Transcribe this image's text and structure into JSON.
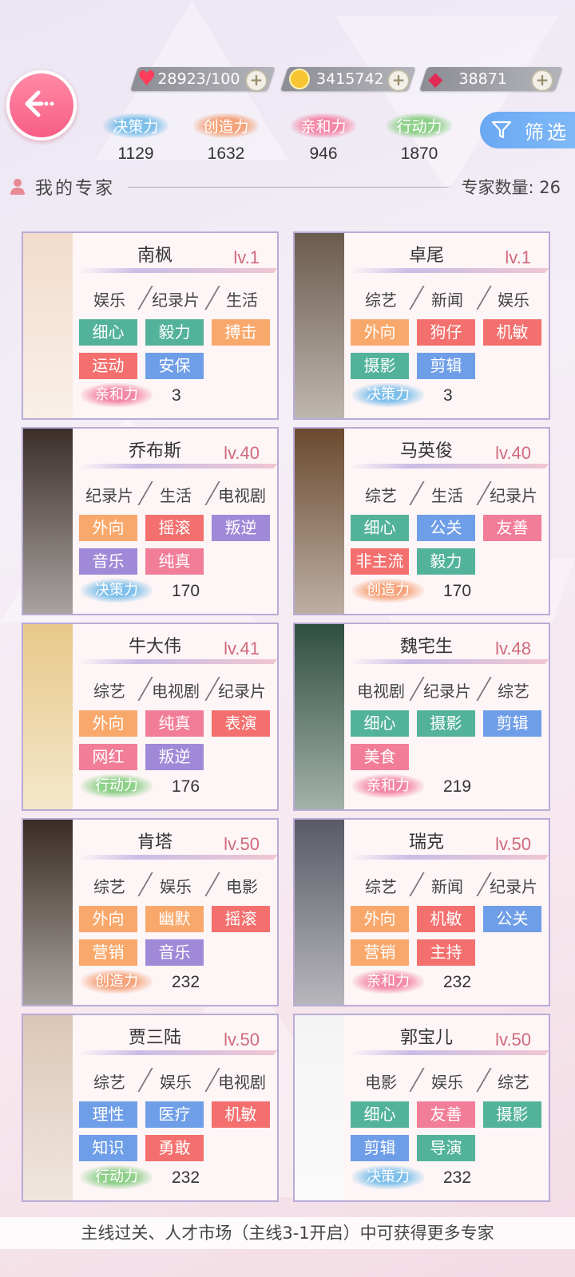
{
  "resources": [
    {
      "icon": "heart-icon",
      "value": "28923/100"
    },
    {
      "icon": "coin-icon",
      "value": "3415742"
    },
    {
      "icon": "gem-icon",
      "value": "38871"
    }
  ],
  "stats": [
    {
      "label": "决策力",
      "value": "1129",
      "color": "#7fc0ea"
    },
    {
      "label": "创造力",
      "value": "1632",
      "color": "#f4a37b"
    },
    {
      "label": "亲和力",
      "value": "946",
      "color": "#f388a8"
    },
    {
      "label": "行动力",
      "value": "1870",
      "color": "#8fd08a"
    }
  ],
  "filter_label": "筛选",
  "section": {
    "title": "我的专家",
    "count_label": "专家数量: 26"
  },
  "colors": {
    "green": "#53b39a",
    "red": "#f3706e",
    "orange": "#f9a86b",
    "blue": "#6f9ee8",
    "purple": "#a08ad8",
    "pink": "#f27d98"
  },
  "experts": [
    {
      "name": "南枫",
      "level": "lv.1",
      "cats": [
        "娱乐",
        "纪录片",
        "生活"
      ],
      "tags": [
        {
          "t": "细心",
          "c": "green"
        },
        {
          "t": "毅力",
          "c": "green"
        },
        {
          "t": "搏击",
          "c": "orange"
        },
        {
          "t": "运动",
          "c": "red"
        },
        {
          "t": "安保",
          "c": "blue"
        }
      ],
      "attr": "亲和力",
      "attr_color": "#f388a8",
      "value": "3"
    },
    {
      "name": "卓尾",
      "level": "lv.1",
      "cats": [
        "综艺",
        "新闻",
        "娱乐"
      ],
      "tags": [
        {
          "t": "外向",
          "c": "orange"
        },
        {
          "t": "狗仔",
          "c": "red"
        },
        {
          "t": "机敏",
          "c": "red"
        },
        {
          "t": "摄影",
          "c": "green"
        },
        {
          "t": "剪辑",
          "c": "blue"
        }
      ],
      "attr": "决策力",
      "attr_color": "#7fc0ea",
      "value": "3"
    },
    {
      "name": "乔布斯",
      "level": "lv.40",
      "cats": [
        "纪录片",
        "生活",
        "电视剧"
      ],
      "tags": [
        {
          "t": "外向",
          "c": "orange"
        },
        {
          "t": "摇滚",
          "c": "red"
        },
        {
          "t": "叛逆",
          "c": "purple"
        },
        {
          "t": "音乐",
          "c": "purple"
        },
        {
          "t": "纯真",
          "c": "pink"
        }
      ],
      "attr": "决策力",
      "attr_color": "#7fc0ea",
      "value": "170"
    },
    {
      "name": "马英俊",
      "level": "lv.40",
      "cats": [
        "综艺",
        "生活",
        "纪录片"
      ],
      "tags": [
        {
          "t": "细心",
          "c": "green"
        },
        {
          "t": "公关",
          "c": "blue"
        },
        {
          "t": "友善",
          "c": "pink"
        },
        {
          "t": "非主流",
          "c": "red"
        },
        {
          "t": "毅力",
          "c": "green"
        }
      ],
      "attr": "创造力",
      "attr_color": "#f4a37b",
      "value": "170"
    },
    {
      "name": "牛大伟",
      "level": "lv.41",
      "cats": [
        "综艺",
        "电视剧",
        "纪录片"
      ],
      "tags": [
        {
          "t": "外向",
          "c": "orange"
        },
        {
          "t": "纯真",
          "c": "pink"
        },
        {
          "t": "表演",
          "c": "red"
        },
        {
          "t": "网红",
          "c": "pink"
        },
        {
          "t": "叛逆",
          "c": "purple"
        }
      ],
      "attr": "行动力",
      "attr_color": "#8fd08a",
      "value": "176"
    },
    {
      "name": "魏宅生",
      "level": "lv.48",
      "cats": [
        "电视剧",
        "纪录片",
        "综艺"
      ],
      "tags": [
        {
          "t": "细心",
          "c": "green"
        },
        {
          "t": "摄影",
          "c": "green"
        },
        {
          "t": "剪辑",
          "c": "blue"
        },
        {
          "t": "美食",
          "c": "pink"
        }
      ],
      "attr": "亲和力",
      "attr_color": "#f388a8",
      "value": "219"
    },
    {
      "name": "肯塔",
      "level": "lv.50",
      "cats": [
        "综艺",
        "娱乐",
        "电影"
      ],
      "tags": [
        {
          "t": "外向",
          "c": "orange"
        },
        {
          "t": "幽默",
          "c": "orange"
        },
        {
          "t": "摇滚",
          "c": "red"
        },
        {
          "t": "营销",
          "c": "orange"
        },
        {
          "t": "音乐",
          "c": "purple"
        }
      ],
      "attr": "创造力",
      "attr_color": "#f4a37b",
      "value": "232"
    },
    {
      "name": "瑞克",
      "level": "lv.50",
      "cats": [
        "综艺",
        "新闻",
        "纪录片"
      ],
      "tags": [
        {
          "t": "外向",
          "c": "orange"
        },
        {
          "t": "机敏",
          "c": "red"
        },
        {
          "t": "公关",
          "c": "blue"
        },
        {
          "t": "营销",
          "c": "orange"
        },
        {
          "t": "主持",
          "c": "red"
        }
      ],
      "attr": "亲和力",
      "attr_color": "#f388a8",
      "value": "232"
    },
    {
      "name": "贾三陆",
      "level": "lv.50",
      "cats": [
        "综艺",
        "娱乐",
        "电视剧"
      ],
      "tags": [
        {
          "t": "理性",
          "c": "blue"
        },
        {
          "t": "医疗",
          "c": "blue"
        },
        {
          "t": "机敏",
          "c": "red"
        },
        {
          "t": "知识",
          "c": "blue"
        },
        {
          "t": "勇敢",
          "c": "red"
        }
      ],
      "attr": "行动力",
      "attr_color": "#8fd08a",
      "value": "232"
    },
    {
      "name": "郭宝儿",
      "level": "lv.50",
      "cats": [
        "电影",
        "娱乐",
        "综艺"
      ],
      "tags": [
        {
          "t": "细心",
          "c": "green"
        },
        {
          "t": "友善",
          "c": "pink"
        },
        {
          "t": "摄影",
          "c": "green"
        },
        {
          "t": "剪辑",
          "c": "blue"
        },
        {
          "t": "导演",
          "c": "green"
        }
      ],
      "attr": "决策力",
      "attr_color": "#7fc0ea",
      "value": "232"
    }
  ],
  "footer": "主线过关、人才市场（主线3-1开启）中可获得更多专家"
}
